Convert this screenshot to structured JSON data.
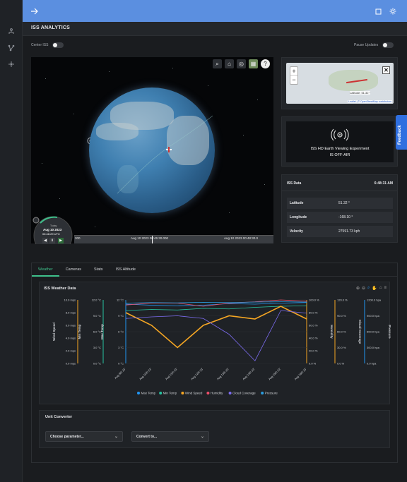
{
  "header": {
    "title": "ISS ANALYTICS"
  },
  "toggles": {
    "center_iss_label": "Center ISS",
    "pause_updates_label": "Pause Updates"
  },
  "globe": {
    "time_ribbon_label": "Today",
    "clock_date": "Aug 10 2023",
    "clock_time": "06:48:29 UTC",
    "timeline_ticks": [
      "300",
      "Aug 10 2023 00:45:30.000",
      "Aug 10 2023 00:48:30.0"
    ]
  },
  "map": {
    "zoom_in": "+",
    "zoom_out": "−",
    "coord_text": "Latitude: 51.32 °",
    "attribution": "Leaflet | © OpenStreetMap contributors"
  },
  "viewing": {
    "line1": "ISS HD Earth Viewing Experiment",
    "line2": "IS OFF-AIR"
  },
  "iss_data": {
    "title": "ISS Data",
    "time": "6:48:31 AM",
    "rows": [
      {
        "key": "Latitude",
        "value": "51.32 °"
      },
      {
        "key": "Longitude",
        "value": "-168.10 °"
      },
      {
        "key": "Velocity",
        "value": "27591.73 kph"
      }
    ]
  },
  "feedback": "Feedback",
  "tabs": [
    "Weather",
    "Cameras",
    "Stats",
    "ISS Altitude"
  ],
  "weather": {
    "title": "ISS Weather Data"
  },
  "unit_converter": {
    "title": "Unit Converter",
    "param_placeholder": "Choose parameter...",
    "convert_placeholder": "Convert to..."
  },
  "chart_data": {
    "type": "line",
    "x": [
      "Aug 9th 23'",
      "Aug 10th 23'",
      "Aug 11th 23'",
      "Aug 12th 23'",
      "Aug 13th 23'",
      "Aug 14th 23'",
      "Aug 15th 23'",
      "Aug 16th 23'"
    ],
    "series": [
      {
        "name": "Max Temp",
        "color": "#2196f3",
        "values": [
          11.2,
          11.0,
          10.9,
          11.0,
          11.3,
          11.2,
          11.4,
          11.5
        ]
      },
      {
        "name": "Min Temp",
        "color": "#27c2a0",
        "values": [
          10.0,
          10.2,
          10.1,
          10.4,
          10.3,
          10.6,
          10.8,
          10.9
        ]
      },
      {
        "name": "Wind Speed",
        "color": "#f5a623",
        "values": [
          8.0,
          6.0,
          2.5,
          6.0,
          7.5,
          7.0,
          9.0,
          7.0
        ]
      },
      {
        "name": "Humidity",
        "color": "#ec4f6a",
        "values": [
          92,
          95,
          95,
          90,
          95,
          97,
          100,
          98
        ]
      },
      {
        "name": "Cloud Coverage",
        "color": "#7c6cf0",
        "values": [
          85,
          88,
          90,
          85,
          55,
          5,
          100,
          95
        ]
      },
      {
        "name": "Pressure",
        "color": "#2a9de0",
        "values": [
          1140,
          1150,
          1145,
          1155,
          1150,
          1160,
          1165,
          1160
        ]
      }
    ],
    "axes": [
      {
        "label": "Wind Speed",
        "color": "#f5a623",
        "ticks": [
          "10.0 mps",
          "8.0 mps",
          "6.0 mps",
          "4.0 mps",
          "2.0 mps",
          "0.0 mps"
        ]
      },
      {
        "label": "Min Temp",
        "color": "#27c2a0",
        "ticks": [
          "12.0 °C",
          "9.0 °C",
          "6.0 °C",
          "3.0 °C",
          "0.0 °C"
        ]
      },
      {
        "label": "Max Temp",
        "color": "#2196f3",
        "ticks": [
          "12 °C",
          "9 °C",
          "6 °C",
          "3 °C",
          "0 °C"
        ]
      },
      {
        "label": "Humidity",
        "color": "#f5a623",
        "ticks": [
          "100.0 %",
          "80.0 %",
          "60.0 %",
          "40.0 %",
          "20.0 %",
          "0.0 %"
        ]
      },
      {
        "label": "Cloud Coverage",
        "color": "#f5a623",
        "ticks": [
          "120.0 %",
          "90.0 %",
          "60.0 %",
          "30.0 %",
          "0.0 %"
        ]
      },
      {
        "label": "Pressure",
        "color": "#2196f3",
        "ticks": [
          "1200.0 hpa",
          "900.0 hpa",
          "600.0 hpa",
          "300.0 hpa",
          "0.0 hpa"
        ]
      }
    ]
  }
}
